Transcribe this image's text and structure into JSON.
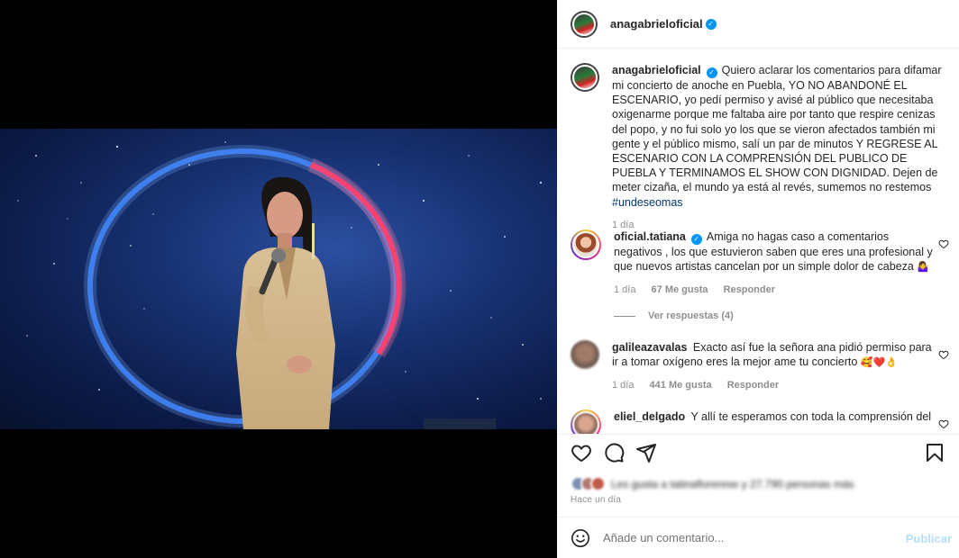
{
  "post": {
    "author": "anagabrieloficial",
    "verified": true
  },
  "caption": {
    "username": "anagabrieloficial",
    "text_before_tag": "Quiero aclarar los comentarios para difamar mi concierto de anoche en Puebla, YO NO ABANDONÉ EL ESCENARIO, yo pedí permiso y avisé al público que necesitaba oxigenarme porque me faltaba aire por tanto que respire cenizas del popo, y no fui solo yo los que se vieron afectados también mi gente y el público mismo, salí un par de minutos Y REGRESE AL ESCENARIO CON LA COMPRENSIÓN DEL PUBLICO DE PUEBLA Y TERMINAMOS EL SHOW CON DIGNIDAD. Dejen de meter cizaña, el mundo ya está al revés, sumemos no restemos ",
    "hashtag": "#undeseomas",
    "time": "1 día"
  },
  "comments": [
    {
      "username": "oficial.tatiana",
      "verified": true,
      "text": "Amiga no hagas caso a comentarios negativos , los que estuvieron saben que eres una profesional y que nuevos artistas cancelan por un simple dolor de cabeza",
      "emoji": "🤷‍♀️",
      "time": "1 día",
      "likes": "67 Me gusta",
      "reply_label": "Responder",
      "view_replies": "Ver respuestas (4)"
    },
    {
      "username": "galileazavalas",
      "verified": false,
      "text": "Exacto así fue la señora ana pidió permiso para ir a tomar oxígeno eres la mejor ame tu concierto",
      "emoji": "🥰❤️👌",
      "time": "1 día",
      "likes": "441 Me gusta",
      "reply_label": "Responder"
    },
    {
      "username": "eliel_delgado",
      "verified": false,
      "text": "Y allí te esperamos con toda la comprensión del"
    }
  ],
  "likes_summary": "Les gusta a tatinaflorerese y 27.790 personas más",
  "time_ago": "Hace un día",
  "add_comment": {
    "placeholder": "Añade un comentario...",
    "publish_label": "Publicar"
  },
  "icons": [
    "heart-icon",
    "comment-icon",
    "share-icon",
    "bookmark-icon",
    "emoji-icon",
    "verified-icon"
  ],
  "colors": {
    "accent": "#0095f6",
    "publish_disabled": "#b2dffc",
    "hashtag": "#00376b",
    "muted": "#8e8e8e"
  }
}
